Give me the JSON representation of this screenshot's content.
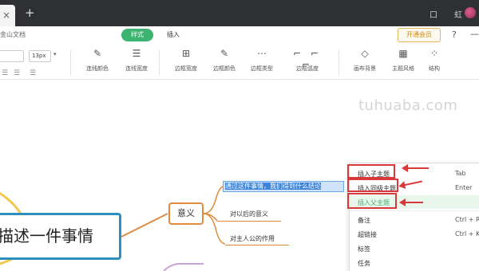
{
  "titlebar": {
    "tab_close": "×",
    "new_tab": "+",
    "right_icons": [
      "口",
      "虹"
    ]
  },
  "toolbar": {
    "brand": "金山文档",
    "tab_style": "样式",
    "tab_insert": "插入",
    "vip_button": "开通会员",
    "help": "?",
    "minimize": "—",
    "font_family": "",
    "font_size": "13px",
    "tools": [
      {
        "label": "连线颜色",
        "icon": "line-color-icon",
        "glyph": "✎"
      },
      {
        "label": "连线宽度",
        "icon": "line-width-icon",
        "glyph": "☰"
      },
      {
        "label": "边框宽度",
        "icon": "border-width-icon",
        "glyph": "⊞"
      },
      {
        "label": "边框颜色",
        "icon": "border-color-icon",
        "glyph": "✎"
      },
      {
        "label": "边框类型",
        "icon": "border-type-icon",
        "glyph": "⋯"
      },
      {
        "label": "边框弧度",
        "icon": "border-radius-icon",
        "glyph": "⌐"
      },
      {
        "label": "画布背景",
        "icon": "canvas-bg-icon",
        "glyph": "◇"
      },
      {
        "label": "主题风格",
        "icon": "theme-icon",
        "glyph": "▦"
      },
      {
        "label": "结构",
        "icon": "structure-icon",
        "glyph": "⁘"
      }
    ]
  },
  "canvas": {
    "watermark": "tuhuaba.com",
    "root_node": "描述一件事情",
    "meaning_node": "意义",
    "edit_node": "通过这件事情，我们得到什么结论",
    "sub_nodes": [
      "对以后的意义",
      "对主人公的作用"
    ]
  },
  "context_menu": {
    "items": [
      {
        "label": "插入子主题",
        "shortcut": "Tab"
      },
      {
        "label": "插入同级主题",
        "shortcut": "Enter"
      },
      {
        "label": "插入父主题",
        "shortcut": ""
      },
      {
        "label": "备注",
        "shortcut": "Ctrl + R"
      },
      {
        "label": "超链接",
        "shortcut": "Ctrl + K"
      },
      {
        "label": "标签",
        "shortcut": ""
      },
      {
        "label": "任务",
        "shortcut": ""
      }
    ]
  },
  "colors": {
    "accent_green": "#3cb371",
    "annotation_red": "#d9393b",
    "root_border": "#2e8fbf",
    "branch_orange": "#e08a3c"
  }
}
